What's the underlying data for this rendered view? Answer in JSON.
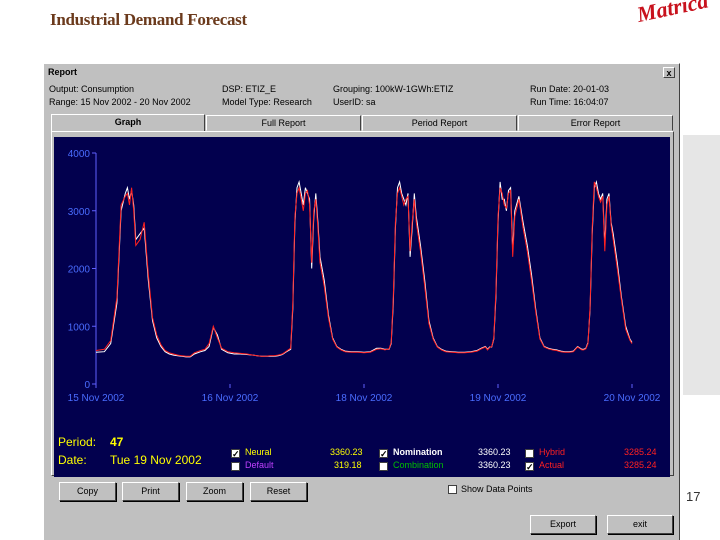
{
  "slide": {
    "title": "Industrial Demand Forecast",
    "logo": "Matrica",
    "page_number": "17"
  },
  "window": {
    "title": "Report",
    "close": "x",
    "info": {
      "output": "Output: Consumption",
      "range": "Range: 15 Nov 2002 - 20 Nov 2002",
      "dsp": "DSP: ETIZ_E",
      "model_type": "Model Type: Research",
      "grouping": "Grouping: 100kW-1GWh:ETIZ",
      "user_id": "UserID: sa",
      "run_date": "Run Date: 20-01-03",
      "run_time": "Run Time: 16:04:07"
    },
    "tabs": [
      {
        "label": "Graph",
        "active": true
      },
      {
        "label": "Full Report",
        "active": false
      },
      {
        "label": "Period Report",
        "active": false
      },
      {
        "label": "Error Report",
        "active": false
      }
    ],
    "period_label": "Period:",
    "period_value": "47",
    "date_label": "Date:",
    "date_value": "Tue 19 Nov 2002",
    "legend": [
      {
        "label": "Neural",
        "value": "3360.23",
        "checked": true,
        "color": "#ffff00"
      },
      {
        "label": "Default",
        "value": "319.18",
        "checked": false,
        "color": "#c040ff"
      },
      {
        "label": "Nomination",
        "value": "3360.23",
        "checked": true,
        "color": "#ffffff"
      },
      {
        "label": "Combination",
        "value": "3360.23",
        "checked": false,
        "color": "#00c000"
      },
      {
        "label": "Hybrid",
        "value": "3285.24",
        "checked": false,
        "color": "#ff2020"
      },
      {
        "label": "Actual",
        "value": "3285.24",
        "checked": true,
        "color": "#ff2020"
      }
    ],
    "show_data_points": "Show Data Points",
    "buttons": {
      "copy": "Copy",
      "print": "Print",
      "zoom": "Zoom",
      "reset": "Reset",
      "export": "Export",
      "exit": "exit"
    }
  },
  "chart_data": {
    "type": "line",
    "title": "",
    "xlabel": "",
    "ylabel": "",
    "ylim": [
      0,
      4000
    ],
    "yticks": [
      "4000",
      "3000",
      "2000",
      "1000",
      "0"
    ],
    "xticks": [
      "15 Nov 2002",
      "16 Nov 2002",
      "18 Nov 2002",
      "19 Nov 2002",
      "20 Nov 2002"
    ],
    "x_period_index": [
      0,
      8,
      14,
      20,
      24,
      28,
      30,
      32,
      34,
      36,
      38,
      42,
      46,
      50,
      54,
      58,
      62,
      66,
      70,
      74,
      78,
      82,
      86,
      90,
      94,
      100,
      104,
      108,
      112,
      116,
      120,
      126,
      132,
      138,
      144,
      150,
      154,
      158,
      162,
      166,
      170,
      174,
      178,
      182,
      186,
      188,
      190,
      192,
      194,
      196,
      198,
      200,
      202,
      204,
      206,
      208,
      210,
      212,
      214,
      218,
      222,
      226,
      230,
      234,
      238,
      244,
      250,
      256,
      262,
      268,
      272,
      276,
      280,
      282,
      284,
      286,
      288,
      290,
      292,
      294,
      296,
      298,
      300,
      302,
      304,
      306,
      310,
      314,
      318,
      322,
      326,
      330,
      334,
      340,
      346,
      352,
      358,
      364,
      368,
      372,
      374,
      376,
      378,
      380,
      382,
      384,
      386,
      388,
      390,
      392,
      394,
      396,
      398,
      400,
      404,
      408,
      412,
      416,
      420,
      424,
      428,
      432,
      436,
      440,
      444,
      448,
      452,
      456,
      460,
      464,
      466,
      468,
      470,
      472,
      474,
      476,
      478,
      480,
      482,
      484,
      486,
      488,
      490,
      492,
      494,
      498,
      502,
      506,
      510,
      512
    ],
    "series": [
      {
        "name": "Nomination",
        "color": "#ffffff",
        "values": [
          550,
          560,
          700,
          1400,
          3000,
          3300,
          3400,
          3200,
          3350,
          3100,
          2500,
          2600,
          2700,
          1800,
          1100,
          800,
          650,
          560,
          520,
          500,
          490,
          480,
          470,
          470,
          520,
          560,
          580,
          650,
          980,
          850,
          600,
          540,
          520,
          520,
          510,
          500,
          490,
          480,
          480,
          480,
          480,
          490,
          510,
          560,
          600,
          1300,
          2800,
          3400,
          3500,
          3300,
          3100,
          3400,
          3300,
          3200,
          2000,
          2900,
          3300,
          2800,
          2200,
          1800,
          1200,
          800,
          650,
          600,
          570,
          560,
          560,
          550,
          560,
          620,
          620,
          600,
          600,
          700,
          1400,
          2700,
          3400,
          3500,
          3300,
          3200,
          3100,
          3300,
          2200,
          2700,
          3300,
          2900,
          2400,
          1800,
          1100,
          800,
          650,
          600,
          570,
          560,
          550,
          550,
          560,
          580,
          620,
          650,
          600,
          640,
          640,
          780,
          1500,
          2800,
          3500,
          3200,
          3200,
          3000,
          3350,
          3400,
          2300,
          3000,
          3250,
          2800,
          2400,
          1900,
          1300,
          800,
          650,
          620,
          600,
          590,
          570,
          560,
          560,
          570,
          650,
          600,
          600,
          620,
          720,
          1300,
          2600,
          3400,
          3500,
          3300,
          3200,
          3300,
          2400,
          3200,
          3300,
          2800,
          2600,
          2100,
          1500,
          1000,
          780,
          720,
          690,
          690
        ]
      },
      {
        "name": "Actual",
        "color": "#ff2020",
        "values": [
          580,
          600,
          750,
          1500,
          3100,
          3250,
          3300,
          3100,
          3400,
          3000,
          2400,
          2500,
          2800,
          1900,
          1150,
          850,
          680,
          580,
          540,
          520,
          500,
          490,
          480,
          480,
          540,
          580,
          600,
          700,
          1000,
          800,
          620,
          560,
          540,
          530,
          520,
          500,
          490,
          480,
          480,
          490,
          490,
          500,
          520,
          570,
          620,
          1400,
          2900,
          3300,
          3400,
          3200,
          3000,
          3300,
          3350,
          3100,
          2100,
          3000,
          3200,
          2700,
          2100,
          1700,
          1150,
          780,
          640,
          590,
          560,
          550,
          550,
          540,
          550,
          600,
          610,
          590,
          610,
          720,
          1500,
          2800,
          3300,
          3400,
          3250,
          3100,
          3200,
          3250,
          2300,
          2800,
          3200,
          2800,
          2300,
          1700,
          1050,
          780,
          640,
          590,
          560,
          550,
          540,
          540,
          550,
          570,
          610,
          640,
          590,
          630,
          650,
          800,
          1600,
          2900,
          3400,
          3300,
          3100,
          3050,
          3300,
          3350,
          2200,
          2900,
          3200,
          2700,
          2300,
          1800,
          1250,
          780,
          640,
          610,
          590,
          580,
          560,
          550,
          550,
          560,
          640,
          590,
          590,
          610,
          700,
          1350,
          2700,
          3500,
          3400,
          3250,
          3150,
          3250,
          2300,
          3100,
          3250,
          2750,
          2500,
          2000,
          1450,
          950,
          760,
          700,
          680,
          680
        ]
      }
    ]
  }
}
